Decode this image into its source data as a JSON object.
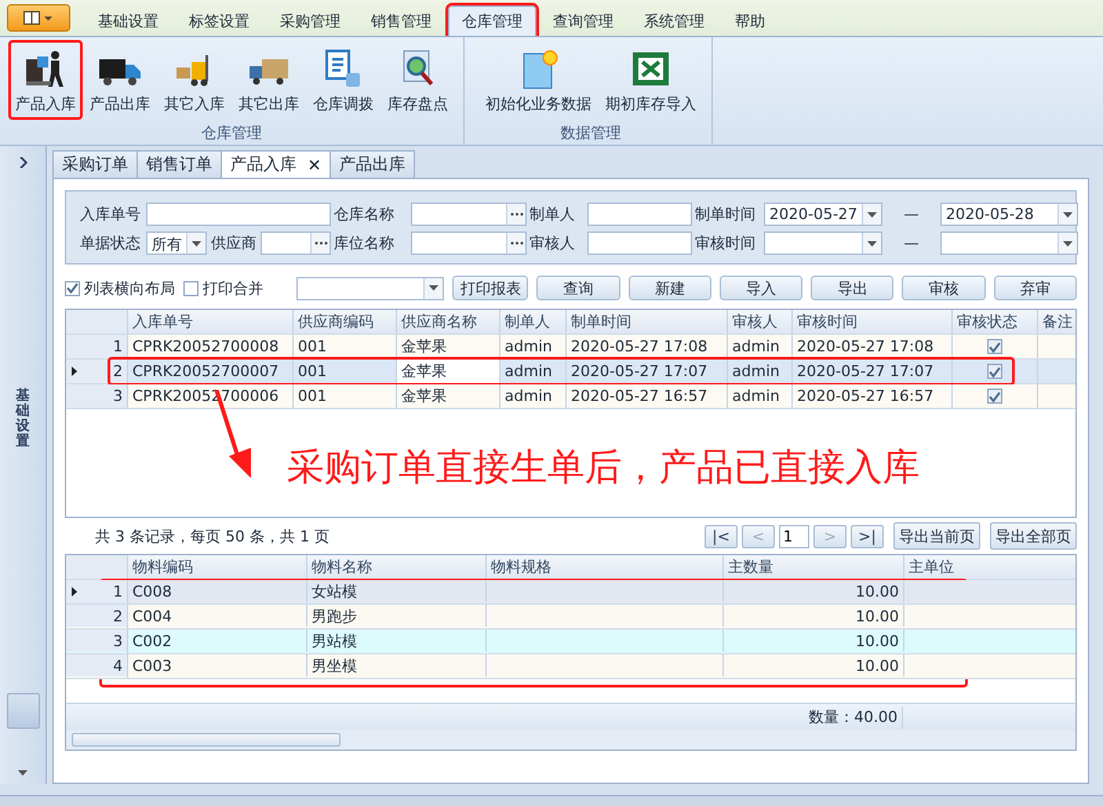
{
  "ribbon_tabs": [
    {
      "label": "基础设置",
      "selected": false
    },
    {
      "label": "标签设置",
      "selected": false
    },
    {
      "label": "采购管理",
      "selected": false
    },
    {
      "label": "销售管理",
      "selected": false
    },
    {
      "label": "仓库管理",
      "selected": true,
      "highlighted": true
    },
    {
      "label": "查询管理",
      "selected": false
    },
    {
      "label": "系统管理",
      "selected": false
    },
    {
      "label": "帮助",
      "selected": false
    }
  ],
  "ribbon_groups": [
    {
      "title": "仓库管理",
      "buttons": [
        {
          "label": "产品入库",
          "highlighted": true
        },
        {
          "label": "产品出库",
          "highlighted": false
        },
        {
          "label": "其它入库",
          "highlighted": false
        },
        {
          "label": "其它出库",
          "highlighted": false
        },
        {
          "label": "仓库调拨",
          "highlighted": false
        },
        {
          "label": "库存盘点",
          "highlighted": false
        }
      ]
    },
    {
      "title": "数据管理",
      "buttons": [
        {
          "label": "初始化业务数据",
          "highlighted": false
        },
        {
          "label": "期初库存导入",
          "highlighted": false
        }
      ]
    }
  ],
  "sidebar": {
    "title": "基础设置"
  },
  "doc_tabs": [
    {
      "label": "采购订单",
      "selected": false
    },
    {
      "label": "销售订单",
      "selected": false
    },
    {
      "label": "产品入库",
      "selected": true,
      "close": "✕"
    },
    {
      "label": "产品出库",
      "selected": false
    }
  ],
  "filters": [
    [
      [
        {
          "kind": "label",
          "text": "入库单号"
        }
      ],
      [
        {
          "kind": "text"
        }
      ],
      [
        {
          "kind": "label",
          "text": "仓库名称"
        }
      ],
      [
        {
          "kind": "lookup"
        }
      ],
      [
        {
          "kind": "label",
          "text": "制单人"
        }
      ],
      [
        {
          "kind": "text"
        }
      ],
      [
        {
          "kind": "label",
          "text": "制单时间"
        }
      ],
      [
        {
          "kind": "date",
          "value": "2020-05-27"
        }
      ],
      [
        {
          "kind": "dash",
          "text": "—"
        }
      ],
      [
        {
          "kind": "date",
          "value": "2020-05-28"
        }
      ]
    ],
    [
      [
        {
          "kind": "label",
          "text": "单据状态"
        }
      ],
      [
        {
          "kind": "select",
          "value": "所有"
        },
        {
          "kind": "label",
          "text": "供应商"
        },
        {
          "kind": "lookup"
        }
      ],
      [
        {
          "kind": "label",
          "text": "库位名称"
        }
      ],
      [
        {
          "kind": "lookup"
        }
      ],
      [
        {
          "kind": "label",
          "text": "审核人"
        }
      ],
      [
        {
          "kind": "text"
        }
      ],
      [
        {
          "kind": "label",
          "text": "审核时间"
        }
      ],
      [
        {
          "kind": "date"
        }
      ],
      [
        {
          "kind": "dash",
          "text": "—"
        }
      ],
      [
        {
          "kind": "date"
        }
      ]
    ]
  ],
  "options": [
    {
      "label": "列表横向布局",
      "checked": true
    },
    {
      "label": "打印合并",
      "checked": false
    }
  ],
  "toolbar_buttons": [
    "打印报表",
    "查询",
    "新建",
    "导入",
    "导出",
    "审核",
    "弃审"
  ],
  "orders": {
    "columns": [
      "入库单号",
      "供应商编码",
      "供应商名称",
      "制单人",
      "制单时间",
      "审核人",
      "审核时间",
      "审核状态",
      "备注"
    ],
    "rows": [
      {
        "index": "1",
        "selected": false,
        "cells": [
          "CPRK20052700008",
          "001",
          "金苹果",
          "admin",
          "2020-05-27 17:08",
          "admin",
          "2020-05-27 17:08"
        ],
        "approved": true
      },
      {
        "index": "2",
        "selected": true,
        "highlighted": true,
        "cells": [
          "CPRK20052700007",
          "001",
          "金苹果",
          "admin",
          "2020-05-27 17:07",
          "admin",
          "2020-05-27 17:07"
        ],
        "approved": true
      },
      {
        "index": "3",
        "selected": false,
        "cells": [
          "CPRK20052700006",
          "001",
          "金苹果",
          "admin",
          "2020-05-27 16:57",
          "admin",
          "2020-05-27 16:57"
        ],
        "approved": true
      }
    ]
  },
  "pager": {
    "summary": "共 3 条记录，每页 50 条，共 1 页",
    "buttons": [
      {
        "label": "|<",
        "disabled": false
      },
      {
        "label": "<",
        "disabled": true
      },
      {
        "label": ">",
        "disabled": true
      },
      {
        "label": ">|",
        "disabled": false
      }
    ],
    "page": "1",
    "export_buttons": [
      "导出当前页",
      "导出全部页"
    ]
  },
  "items": {
    "columns": [
      "物料编码",
      "物料名称",
      "物料规格",
      "主数量",
      "主单位"
    ],
    "rows": [
      {
        "index": "1",
        "selected": true,
        "cells": [
          "C008",
          "女站模",
          "",
          "10.00",
          ""
        ]
      },
      {
        "index": "2",
        "selected": false,
        "cells": [
          "C004",
          "男跑步",
          "",
          "10.00",
          ""
        ]
      },
      {
        "index": "3",
        "selected": false,
        "cells": [
          "C002",
          "男站模",
          "",
          "10.00",
          ""
        ]
      },
      {
        "index": "4",
        "selected": false,
        "cells": [
          "C003",
          "男坐模",
          "",
          "10.00",
          ""
        ]
      }
    ],
    "total": "数量：40.00",
    "highlighted": true
  },
  "annotation": {
    "text": "采购订单直接生单后，产品已直接入库"
  }
}
